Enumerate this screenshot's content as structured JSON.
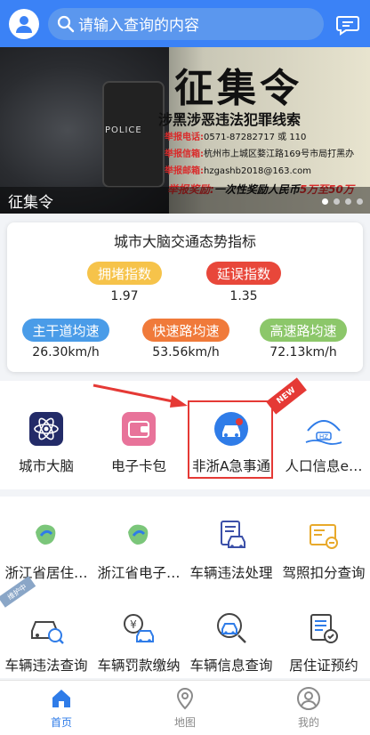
{
  "header": {
    "search_placeholder": "请输入查询的内容"
  },
  "banner": {
    "title": "征集令",
    "subtitle": "涉黑涉恶违法犯罪线索",
    "phone_label": "举报电话:",
    "phone_value": "0571-87282717 或 110",
    "letter_label": "举报信箱:",
    "letter_value": "杭州市上城区婺江路169号市局打黑办",
    "email_label": "举报邮箱:",
    "email_value": "hzgashb2018@163.com",
    "reward_label": "举报奖励:",
    "reward_text": "一次性奖励人民币",
    "reward_amount": "5万至50万",
    "shield_text": "POLICE",
    "caption": "征集令",
    "slide_index": 1,
    "slide_count": 4
  },
  "traffic": {
    "title": "城市大脑交通态势指标",
    "congestion_label": "拥堵指数",
    "congestion_value": "1.97",
    "delay_label": "延误指数",
    "delay_value": "1.35",
    "arterial_label": "主干道均速",
    "arterial_value": "26.30km/h",
    "expressway_label": "快速路均速",
    "expressway_value": "53.56km/h",
    "highway_label": "高速路均速",
    "highway_value": "72.13km/h",
    "colors": {
      "congestion": "#f6c34a",
      "delay": "#e8473a",
      "arterial": "#4a9ce8",
      "expressway": "#f07a3a",
      "highway": "#8cc76a"
    }
  },
  "services_top": [
    {
      "label": "城市大脑",
      "icon": "atom-icon"
    },
    {
      "label": "电子卡包",
      "icon": "wallet-icon"
    },
    {
      "label": "非浙A急事通",
      "icon": "car-alert-icon"
    },
    {
      "label": "人口信息e…",
      "icon": "hz-logo-icon"
    }
  ],
  "new_ribbon": "NEW",
  "services_mid": [
    {
      "label": "浙江省居住…",
      "icon": "zhejiang-map-icon"
    },
    {
      "label": "浙江省电子…",
      "icon": "zhejiang-map-icon"
    },
    {
      "label": "车辆违法处理",
      "icon": "car-document-icon"
    },
    {
      "label": "驾照扣分查询",
      "icon": "license-icon"
    }
  ],
  "maintenance_badge": "维护中",
  "services_bottom": [
    {
      "label": "车辆违法查询",
      "icon": "car-search-icon"
    },
    {
      "label": "车辆罚款缴纳",
      "icon": "yuan-car-icon"
    },
    {
      "label": "车辆信息查询",
      "icon": "car-info-icon"
    },
    {
      "label": "居住证预约",
      "icon": "calendar-check-icon"
    }
  ],
  "nav": [
    {
      "label": "首页",
      "active": true
    },
    {
      "label": "地图",
      "active": false
    },
    {
      "label": "我的",
      "active": false
    }
  ]
}
